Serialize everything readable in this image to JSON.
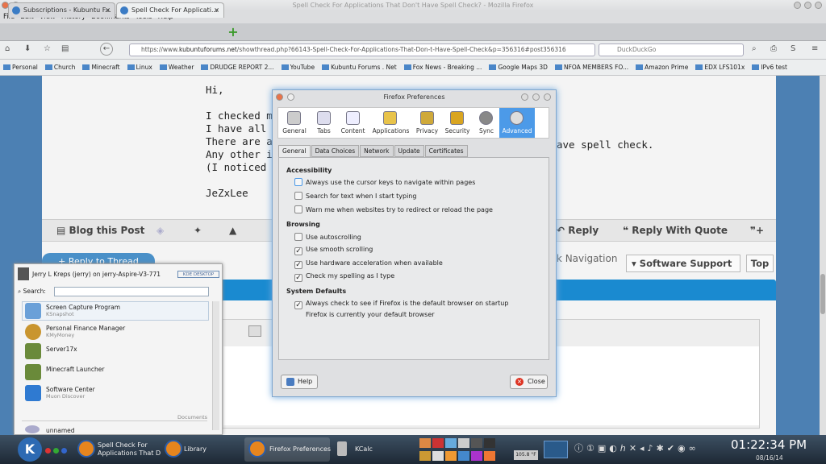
{
  "window": {
    "title": "Spell Check For Applications That Don't Have Spell Check? - Mozilla Firefox"
  },
  "menu": [
    "File",
    "Edit",
    "View",
    "History",
    "Bookmarks",
    "Tools",
    "Help"
  ],
  "tabs": [
    {
      "label": "Subscriptions - Kubuntu F...",
      "active": false
    },
    {
      "label": "Spell Check For Applicati...",
      "active": true
    }
  ],
  "nav": {
    "url_prefix": "https://www.",
    "url_domain": "kubuntuforums.net",
    "url_rest": "/showthread.php?66143-Spell-Check-For-Applications-That-Don-t-Have-Spell-Check&p=356316#post356316",
    "search_placeholder": "DuckDuckGo"
  },
  "bookmarks": [
    "Personal",
    "Church",
    "Minecraft",
    "Linux",
    "Weather",
    "DRUDGE REPORT 2...",
    "YouTube",
    "Kubuntu Forums . Net",
    "Fox News - Breaking ...",
    "Google Maps 3D",
    "NFOA MEMBERS FO...",
    "Amazon Prime",
    "EDX LFS101x",
    "IPv6 test"
  ],
  "post": {
    "lines": [
      "Hi,",
      "",
      "I checked my",
      "I have all the",
      "There are a f",
      "Any other ide",
      "(I noticed tha",
      "",
      "JeZxLee"
    ],
    "spell_fragment": "ave spell check."
  },
  "post_actions": {
    "blog": "Blog this Post",
    "reply": "Reply",
    "reply_quote": "Reply With Quote"
  },
  "thread": {
    "reply_thread": "+ Reply to Thread",
    "quick_nav": "ick Navigation",
    "forum": "Software Support",
    "top": "Top"
  },
  "dialog": {
    "title": "Firefox Preferences",
    "panes": [
      "General",
      "Tabs",
      "Content",
      "Applications",
      "Privacy",
      "Security",
      "Sync",
      "Advanced"
    ],
    "subtabs": [
      "General",
      "Data Choices",
      "Network",
      "Update",
      "Certificates"
    ],
    "sections": {
      "accessibility": "Accessibility",
      "browsing": "Browsing",
      "system": "System Defaults"
    },
    "options": [
      {
        "label": "Always use the cursor keys to navigate within pages",
        "checked": false
      },
      {
        "label": "Search for text when I start typing",
        "checked": false
      },
      {
        "label": "Warn me when websites try to redirect or reload the page",
        "checked": false
      },
      {
        "label": "Use autoscrolling",
        "checked": false
      },
      {
        "label": "Use smooth scrolling",
        "checked": true
      },
      {
        "label": "Use hardware acceleration when available",
        "checked": true
      },
      {
        "label": "Check my spelling as I type",
        "checked": true
      },
      {
        "label": "Always check to see if Firefox is the default browser on startup",
        "checked": true
      }
    ],
    "default_status": "Firefox is currently your default browser",
    "help": "Help",
    "close": "Close"
  },
  "launcher": {
    "user": "Jerry L Kreps (jerry) on jerry-Aspire-V3-771",
    "badge": "KDE DESKTOP",
    "search_label": "Search:",
    "items": [
      {
        "name": "Screen Capture Program",
        "sub": "KSnapshot"
      },
      {
        "name": "Personal Finance Manager",
        "sub": "KMyMoney"
      },
      {
        "name": "Server17x",
        "sub": ""
      },
      {
        "name": "Minecraft Launcher",
        "sub": ""
      },
      {
        "name": "Software Center",
        "sub": "Muon Discover"
      }
    ],
    "documents_header": "Documents",
    "doc_item": "unnamed"
  },
  "taskbar": {
    "tasks": [
      "Spell Check For Applications That D",
      "Library",
      "Firefox Preferences",
      "KCalc"
    ],
    "temp": "105.8 °F",
    "time": "01:22:34 PM",
    "date": "08/16/14"
  }
}
